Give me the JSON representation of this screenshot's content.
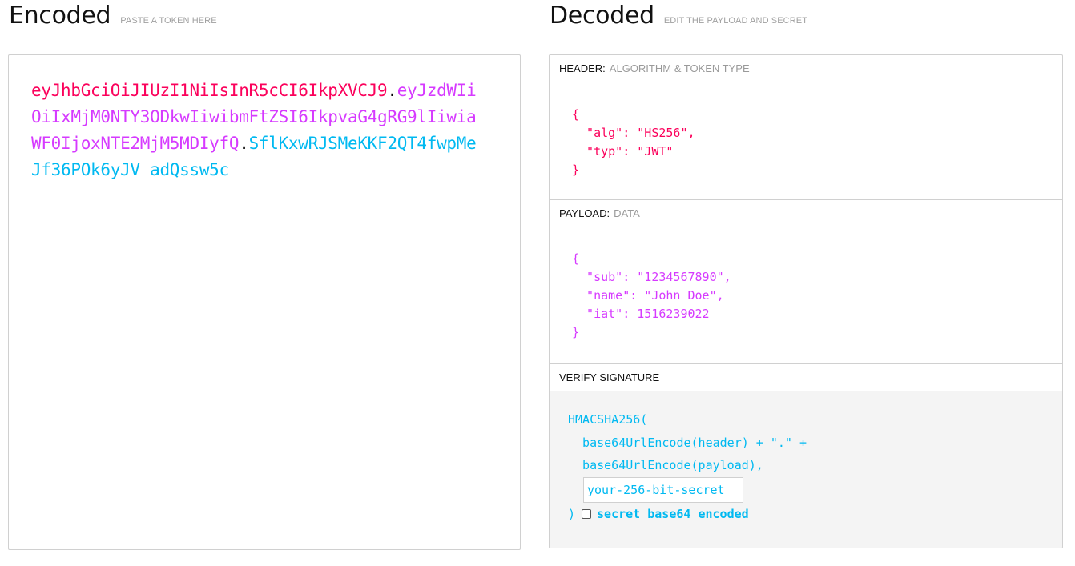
{
  "encoded": {
    "title": "Encoded",
    "subtitle": "PASTE A TOKEN HERE",
    "token": {
      "header": "eyJhbGciOiJIUzI1NiIsInR5cCI6IkpXVCJ9",
      "dot1": ".",
      "payload": "eyJzdWIiOiIxMjM0NTY3ODkwIiwibmFtZSI6IkpvaG4gRG9lIiwiaWF0IjoxNTE2MjM5MDIyfQ",
      "dot2": ".",
      "signature": "SflKxwRJSMeKKF2QT4fwpMeJf36POk6yJV_adQssw5c"
    }
  },
  "decoded": {
    "title": "Decoded",
    "subtitle": "EDIT THE PAYLOAD AND SECRET",
    "header_panel": {
      "label": "HEADER:",
      "sublabel": "ALGORITHM & TOKEN TYPE",
      "json": "{\n  \"alg\": \"HS256\",\n  \"typ\": \"JWT\"\n}"
    },
    "payload_panel": {
      "label": "PAYLOAD:",
      "sublabel": "DATA",
      "json": "{\n  \"sub\": \"1234567890\",\n  \"name\": \"John Doe\",\n  \"iat\": 1516239022\n}"
    },
    "verify_panel": {
      "label": "VERIFY SIGNATURE",
      "line1": "HMACSHA256(",
      "line2": "  base64UrlEncode(header) + \".\" +",
      "line3": "  base64UrlEncode(payload),",
      "secret_placeholder": "your-256-bit-secret",
      "close_paren": ")",
      "base64_checkbox_label": "secret base64 encoded",
      "base64_checked": false
    }
  },
  "colors": {
    "header": "#fb015b",
    "payload": "#d63aff",
    "signature": "#00b9f1"
  }
}
